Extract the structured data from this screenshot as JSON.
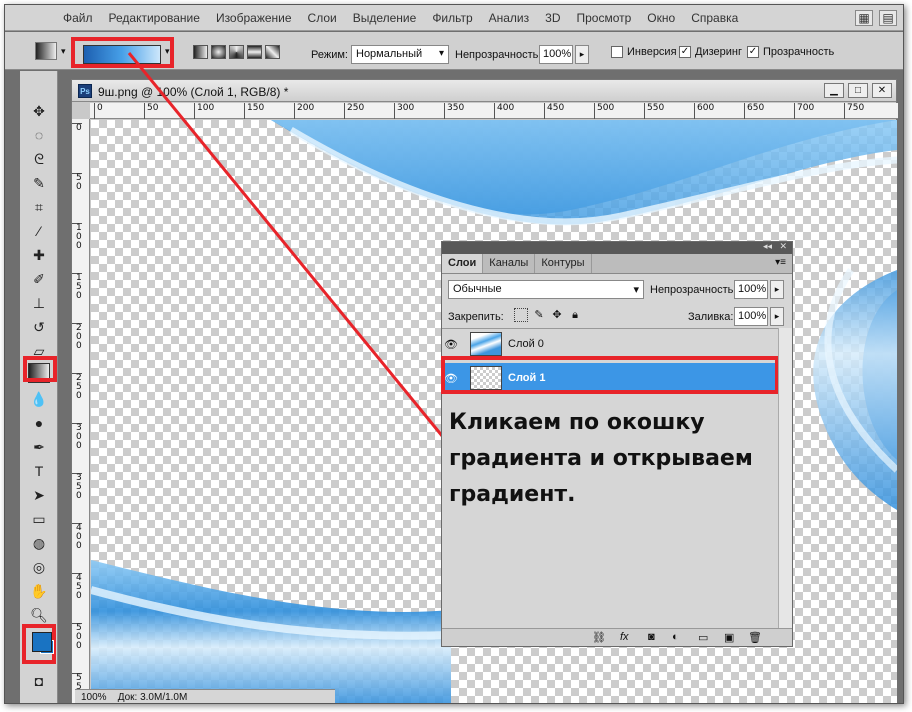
{
  "menubar": {
    "items": [
      "Файл",
      "Редактирование",
      "Изображение",
      "Слои",
      "Выделение",
      "Фильтр",
      "Анализ",
      "3D",
      "Просмотр",
      "Окно",
      "Справка"
    ]
  },
  "options": {
    "mode_label": "Режим:",
    "mode_value": "Нормальный",
    "opacity_label": "Непрозрачность:",
    "opacity_value": "100%",
    "inverse_label": "Инверсия",
    "dither_label": "Дизеринг",
    "transparency_label": "Прозрачность",
    "inverse_checked": false,
    "dither_checked": true,
    "transparency_checked": true
  },
  "document": {
    "title": "9ш.png @ 100% (Слой 1, RGB/8) *",
    "ruler_top": [
      "0",
      "50",
      "100",
      "150",
      "200",
      "250",
      "300",
      "350",
      "400",
      "450",
      "500",
      "550",
      "600",
      "650",
      "700",
      "750"
    ],
    "ruler_left": [
      "0",
      "50",
      "100",
      "150",
      "200",
      "250",
      "300",
      "350",
      "400",
      "450",
      "500",
      "550"
    ],
    "status_zoom": "100%",
    "status_doc": "Док: 3.0M/1.0M"
  },
  "colors": {
    "foreground": "#1973c2",
    "background": "#1973c2",
    "annotation_red": "#e8242a",
    "selected_layer": "#3c96e6"
  },
  "layers_panel": {
    "tabs": [
      "Слои",
      "Каналы",
      "Контуры"
    ],
    "blend_mode": "Обычные",
    "opacity_label": "Непрозрачность:",
    "opacity_value": "100%",
    "lock_label": "Закрепить:",
    "fill_label": "Заливка:",
    "fill_value": "100%",
    "layers": [
      {
        "name": "Слой 0",
        "selected": false,
        "visible": true
      },
      {
        "name": "Слой 1",
        "selected": true,
        "visible": true
      }
    ]
  },
  "annotation": {
    "text": "Кликаем по окошку градиента и открываем градиент."
  }
}
